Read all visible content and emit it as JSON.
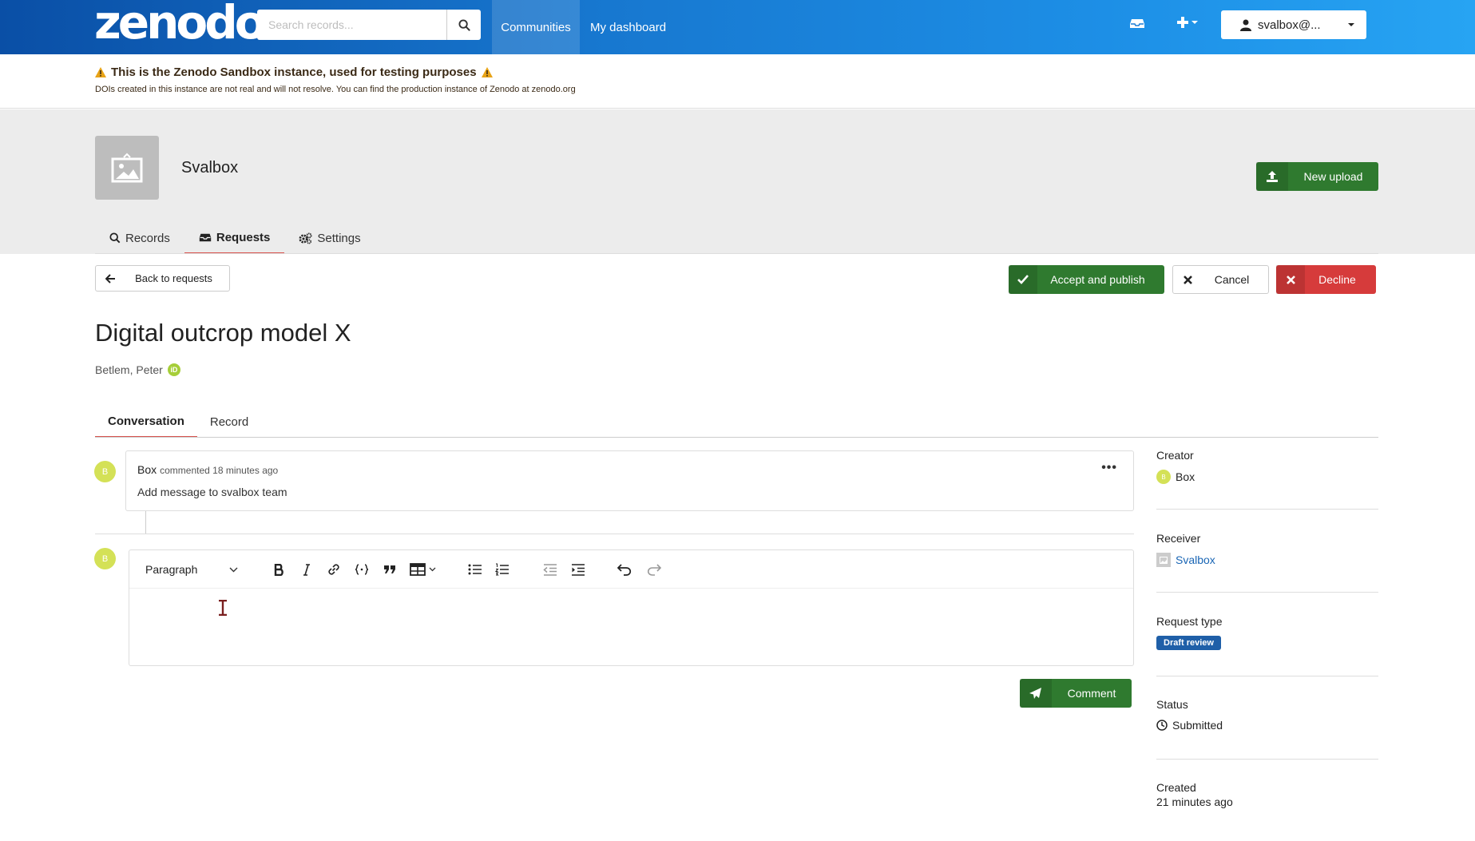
{
  "header": {
    "logo": "zenodo",
    "search_placeholder": "Search records...",
    "nav": {
      "communities": "Communities",
      "dashboard": "My dashboard"
    },
    "user": "svalbox@..."
  },
  "banner": {
    "title": "This is the Zenodo Sandbox instance, used for testing purposes",
    "subtitle": "DOIs created in this instance are not real and will not resolve. You can find the production instance of Zenodo at zenodo.org"
  },
  "community": {
    "name": "Svalbox",
    "new_upload": "New upload",
    "tabs": {
      "records": "Records",
      "requests": "Requests",
      "settings": "Settings"
    }
  },
  "actions": {
    "back": "Back to requests",
    "accept": "Accept and publish",
    "cancel": "Cancel",
    "decline": "Decline"
  },
  "record": {
    "title": "Digital outcrop model X",
    "author": "Betlem, Peter",
    "orcid_label": "iD"
  },
  "req_tabs": {
    "conversation": "Conversation",
    "record": "Record"
  },
  "comment": {
    "avatar": "B",
    "author": "Box",
    "when": "commented 18 minutes ago",
    "body": "Add message to svalbox team",
    "more": "•••"
  },
  "editor": {
    "avatar": "B",
    "paragraph": "Paragraph",
    "submit": "Comment"
  },
  "sidebar": {
    "creator_label": "Creator",
    "creator_avatar": "B",
    "creator": "Box",
    "receiver_label": "Receiver",
    "receiver": "Svalbox",
    "type_label": "Request type",
    "type": "Draft review",
    "status_label": "Status",
    "status": "Submitted",
    "created_label": "Created",
    "created": "21 minutes ago"
  },
  "colors": {
    "accent_green": "#2f7a2f",
    "danger": "#d63b3b",
    "link": "#1a66b5",
    "tab_underline": "#d9534f"
  }
}
